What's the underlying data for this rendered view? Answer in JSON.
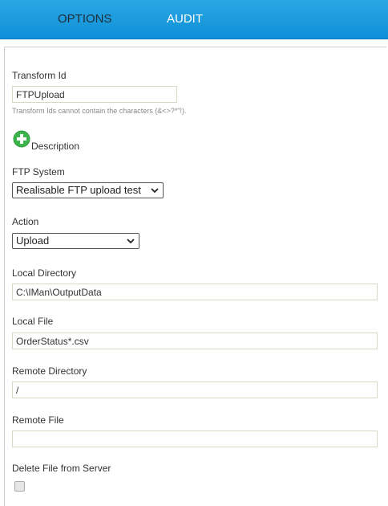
{
  "nav": {
    "tabs": [
      {
        "label": "OPTIONS"
      },
      {
        "label": "AUDIT"
      }
    ]
  },
  "form": {
    "transform_id": {
      "label": "Transform Id",
      "value": "FTPUpload",
      "hint": "Transform Ids cannot contain the characters (&<>?*\"!)."
    },
    "description": {
      "label": "Description",
      "icon": "add-icon"
    },
    "ftp_system": {
      "label": "FTP System",
      "selected": "Realisable FTP upload test"
    },
    "action": {
      "label": "Action",
      "selected": "Upload"
    },
    "local_directory": {
      "label": "Local Directory",
      "value": "C:\\IMan\\OutputData"
    },
    "local_file": {
      "label": "Local File",
      "value": "OrderStatus*.csv"
    },
    "remote_directory": {
      "label": "Remote Directory",
      "value": "/"
    },
    "remote_file": {
      "label": "Remote File",
      "value": ""
    },
    "delete_file": {
      "label": "Delete File from Server",
      "checked": false
    }
  },
  "colors": {
    "topbar": "#1a9be0",
    "add_icon": "#3cb44b"
  }
}
